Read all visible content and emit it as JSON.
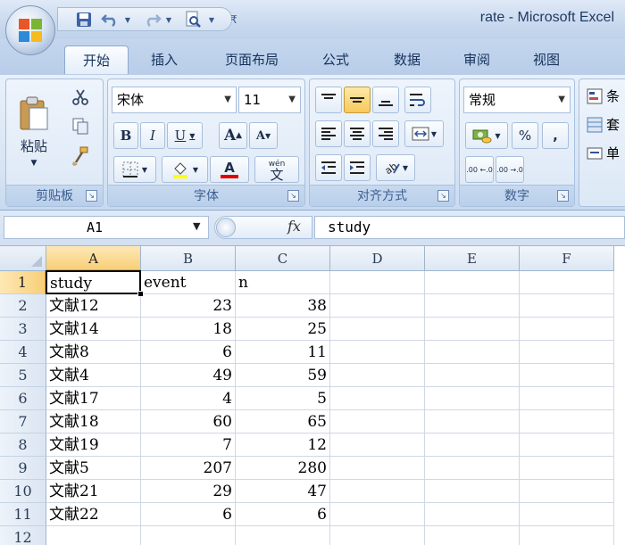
{
  "window": {
    "title": "rate - Microsoft Excel"
  },
  "quick_access": {
    "items": [
      "save-icon",
      "undo-icon",
      "redo-icon",
      "print-preview-icon",
      "customize-icon"
    ]
  },
  "ribbon_tabs": [
    "开始",
    "插入",
    "页面布局",
    "公式",
    "数据",
    "审阅",
    "视图"
  ],
  "active_tab": "开始",
  "ribbon": {
    "clipboard": {
      "label": "剪贴板",
      "paste_label": "粘贴"
    },
    "font": {
      "label": "字体",
      "font_name": "宋体",
      "font_size": "11",
      "bold": "B",
      "italic": "I",
      "underline": "U",
      "grow": "A",
      "shrink": "A",
      "font_color_glyph": "A",
      "phonetic_glyph": "wén",
      "phonetic_char": "文"
    },
    "alignment": {
      "label": "对齐方式"
    },
    "number": {
      "label": "数字",
      "format": "常规",
      "percent": "%",
      "comma": ",",
      "inc_decimal": ".00 ←.0",
      "dec_decimal": ".00 →.0"
    },
    "styles": {
      "partial_labels": [
        "条",
        "套",
        "单"
      ]
    }
  },
  "formula_bar": {
    "name_box": "A1",
    "fx": "fx",
    "content": "study"
  },
  "sheet": {
    "columns": [
      "A",
      "B",
      "C",
      "D",
      "E",
      "F"
    ],
    "rows": [
      "1",
      "2",
      "3",
      "4",
      "5",
      "6",
      "7",
      "8",
      "9",
      "10",
      "11",
      "12"
    ],
    "active_cell": "A1",
    "cells": [
      [
        "study",
        "event",
        "n"
      ],
      [
        "文献12",
        "23",
        "38"
      ],
      [
        "文献14",
        "18",
        "25"
      ],
      [
        "文献8",
        "6",
        "11"
      ],
      [
        "文献4",
        "49",
        "59"
      ],
      [
        "文献17",
        "4",
        "5"
      ],
      [
        "文献18",
        "60",
        "65"
      ],
      [
        "文献19",
        "7",
        "12"
      ],
      [
        "文献5",
        "207",
        "280"
      ],
      [
        "文献21",
        "29",
        "47"
      ],
      [
        "文献22",
        "6",
        "6"
      ]
    ]
  }
}
